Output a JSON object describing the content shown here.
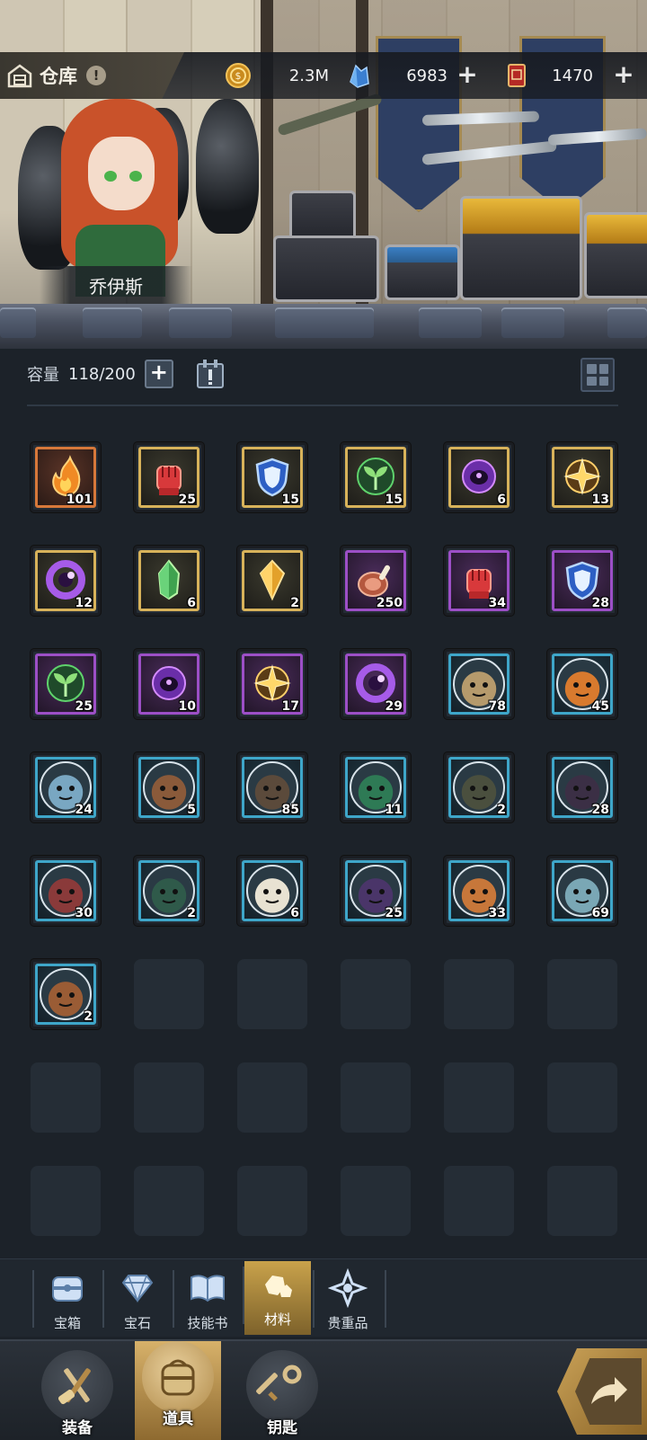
{
  "header": {
    "title": "仓库",
    "info_glyph": "!",
    "gold": "2.3M",
    "crystals": "6983",
    "tickets": "1470",
    "plus_glyph": "+"
  },
  "hero": {
    "name": "乔伊斯"
  },
  "capacity": {
    "label": "容量",
    "value": "118/200",
    "plus_glyph": "+"
  },
  "items": [
    {
      "icon": "flame-icon",
      "rarity": "orange",
      "count": "101"
    },
    {
      "icon": "fist-icon",
      "rarity": "gold",
      "count": "25"
    },
    {
      "icon": "shield-icon",
      "rarity": "gold",
      "count": "15"
    },
    {
      "icon": "sprout-icon",
      "rarity": "gold",
      "count": "15"
    },
    {
      "icon": "dark-orb-icon",
      "rarity": "gold",
      "count": "6"
    },
    {
      "icon": "star-compass-icon",
      "rarity": "gold",
      "count": "13"
    },
    {
      "icon": "purple-ring-icon",
      "rarity": "gold",
      "count": "12"
    },
    {
      "icon": "green-crystal-icon",
      "rarity": "gold",
      "count": "6"
    },
    {
      "icon": "gold-crystal-icon",
      "rarity": "gold",
      "count": "2"
    },
    {
      "icon": "meat-icon",
      "rarity": "purple",
      "count": "250"
    },
    {
      "icon": "fist-icon",
      "rarity": "purple",
      "count": "34"
    },
    {
      "icon": "shield-icon",
      "rarity": "purple",
      "count": "28"
    },
    {
      "icon": "sprout-icon",
      "rarity": "purple",
      "count": "25"
    },
    {
      "icon": "dark-orb-icon",
      "rarity": "purple",
      "count": "10"
    },
    {
      "icon": "star-compass-icon",
      "rarity": "purple",
      "count": "17"
    },
    {
      "icon": "purple-ring-icon",
      "rarity": "purple",
      "count": "29"
    },
    {
      "icon": "monster-portrait-icon",
      "rarity": "blue",
      "count": "78",
      "color": "#b59a6c"
    },
    {
      "icon": "monster-portrait-icon",
      "rarity": "blue",
      "count": "45",
      "color": "#d87a2e"
    },
    {
      "icon": "monster-portrait-icon",
      "rarity": "blue",
      "count": "24",
      "color": "#79a7c2"
    },
    {
      "icon": "monster-portrait-icon",
      "rarity": "blue",
      "count": "5",
      "color": "#8a5a3a"
    },
    {
      "icon": "monster-portrait-icon",
      "rarity": "blue",
      "count": "85",
      "color": "#5b4a3b"
    },
    {
      "icon": "monster-portrait-icon",
      "rarity": "blue",
      "count": "11",
      "color": "#2e7a55"
    },
    {
      "icon": "monster-portrait-icon",
      "rarity": "blue",
      "count": "2",
      "color": "#4a4f3e"
    },
    {
      "icon": "monster-portrait-icon",
      "rarity": "blue",
      "count": "28",
      "color": "#3b2f45"
    },
    {
      "icon": "monster-portrait-icon",
      "rarity": "blue",
      "count": "30",
      "color": "#8a3a3a"
    },
    {
      "icon": "monster-portrait-icon",
      "rarity": "blue",
      "count": "2",
      "color": "#2f5a4a"
    },
    {
      "icon": "monster-portrait-icon",
      "rarity": "blue",
      "count": "6",
      "color": "#e8e2d2"
    },
    {
      "icon": "monster-portrait-icon",
      "rarity": "blue",
      "count": "25",
      "color": "#4a3569"
    },
    {
      "icon": "monster-portrait-icon",
      "rarity": "blue",
      "count": "33",
      "color": "#c7773a"
    },
    {
      "icon": "monster-portrait-icon",
      "rarity": "blue",
      "count": "69",
      "color": "#7aa7b5"
    },
    {
      "icon": "monster-portrait-icon",
      "rarity": "blue",
      "count": "2",
      "color": "#9a5c35"
    }
  ],
  "subtabs": [
    {
      "label": "宝箱",
      "icon": "chest-icon",
      "active": false
    },
    {
      "label": "宝石",
      "icon": "gem-icon",
      "active": false
    },
    {
      "label": "技能书",
      "icon": "book-icon",
      "active": false
    },
    {
      "label": "材料",
      "icon": "ore-icon",
      "active": true
    },
    {
      "label": "贵重品",
      "icon": "treasure-star-icon",
      "active": false
    }
  ],
  "nav": [
    {
      "label": "装备",
      "icon": "sword-axe-icon",
      "active": false
    },
    {
      "label": "道具",
      "icon": "bag-icon",
      "active": true
    },
    {
      "label": "钥匙",
      "icon": "key-icon",
      "active": false
    }
  ],
  "colors": {
    "bg": "#1c2229",
    "rarity_orange": "#d7783a",
    "rarity_gold": "#d7b25a",
    "rarity_purple": "#9c4fc6",
    "rarity_blue": "#3ea6c9",
    "active_tab": "#c9a24b"
  }
}
